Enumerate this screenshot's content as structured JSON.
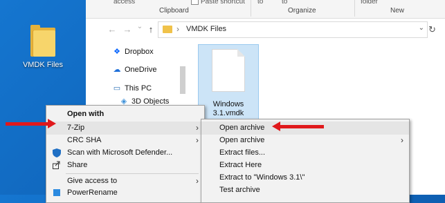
{
  "desktop": {
    "icon_label": "VMDK Files"
  },
  "ribbon": {
    "frag_access": "access",
    "frag_paste_shortcut": "Paste shortcut",
    "frag_to1": "to",
    "frag_to2": "to",
    "frag_folder": "folder",
    "group_clipboard": "Clipboard",
    "group_organize": "Organize",
    "group_new": "New"
  },
  "address": {
    "path": "VMDK Files",
    "back_glyph": "←",
    "forward_glyph": "→",
    "recent_glyph": "⌄",
    "up_glyph": "↑",
    "dropdown_glyph": "⌄",
    "refresh_glyph": "↻"
  },
  "navpane": {
    "items": [
      {
        "label": "Dropbox",
        "icon": "dropbox-icon",
        "glyph": "❖"
      },
      {
        "label": "OneDrive",
        "icon": "cloud-icon",
        "glyph": "☁"
      },
      {
        "label": "This PC",
        "icon": "computer-icon",
        "glyph": "▭"
      },
      {
        "label": "3D Objects",
        "icon": "cube-icon",
        "glyph": "◈"
      }
    ]
  },
  "file": {
    "name": "Windows 3.1.vmdk"
  },
  "context_menu": {
    "items": [
      {
        "label": "Open with",
        "bold": true
      },
      {
        "label": "7-Zip",
        "submenu": true
      },
      {
        "label": "CRC SHA",
        "submenu": true
      },
      {
        "label": "Scan with Microsoft Defender...",
        "icon": "defender-shield-icon"
      },
      {
        "label": "Share",
        "icon": "share-icon"
      },
      {
        "label": "Give access to",
        "submenu": true
      },
      {
        "label": "PowerRename",
        "icon": "powerrename-icon"
      }
    ]
  },
  "submenu_7zip": {
    "items": [
      {
        "label": "Open archive"
      },
      {
        "label": "Open archive",
        "submenu": true
      },
      {
        "label": "Extract files..."
      },
      {
        "label": "Extract Here"
      },
      {
        "label": "Extract to \"Windows 3.1\\\""
      },
      {
        "label": "Test archive"
      }
    ]
  },
  "colors": {
    "desktop": "#1576d0",
    "arrow": "#e0191c",
    "selection": "#cce4f7"
  }
}
